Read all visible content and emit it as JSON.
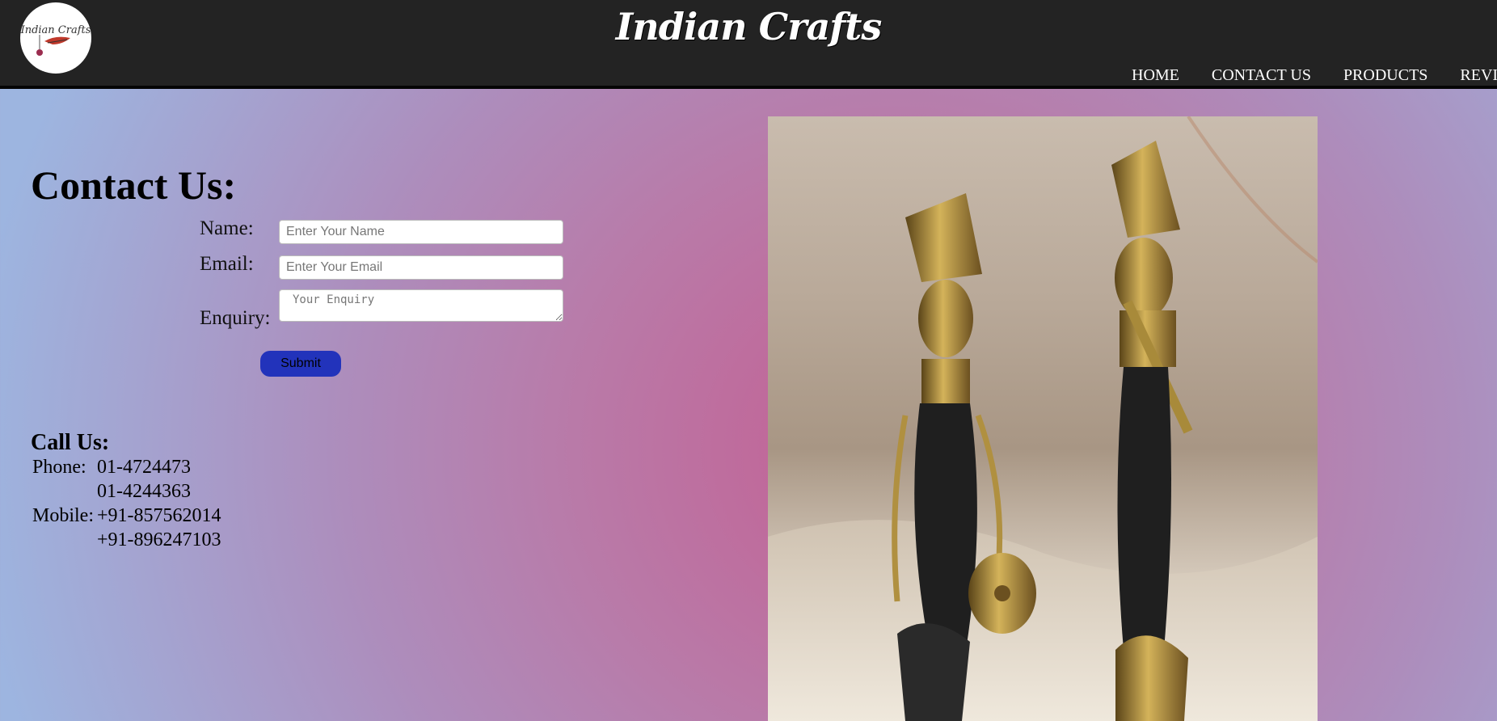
{
  "header": {
    "brand": "Indian Crafts",
    "logo_text": "Indian Crafts",
    "nav": [
      "HOME",
      "CONTACT US",
      "PRODUCTS",
      "REVIEWS"
    ]
  },
  "contact": {
    "title": "Contact Us:",
    "name_label": "Name:",
    "name_placeholder": "Enter Your Name",
    "email_label": "Email:",
    "email_placeholder": "Enter Your Email",
    "enquiry_label": "Enquiry:",
    "enquiry_placeholder": "Your Enquiry",
    "submit_label": "Submit"
  },
  "call": {
    "title": "Call Us:",
    "phone_label": "Phone:",
    "phones": [
      "01-4724473",
      "01-4244363"
    ],
    "mobile_label": "Mobile:",
    "mobiles": [
      "+91-857562014",
      "+91-896247103"
    ]
  },
  "colors": {
    "header_bg": "#232323",
    "submit_bg": "#2233bb"
  }
}
